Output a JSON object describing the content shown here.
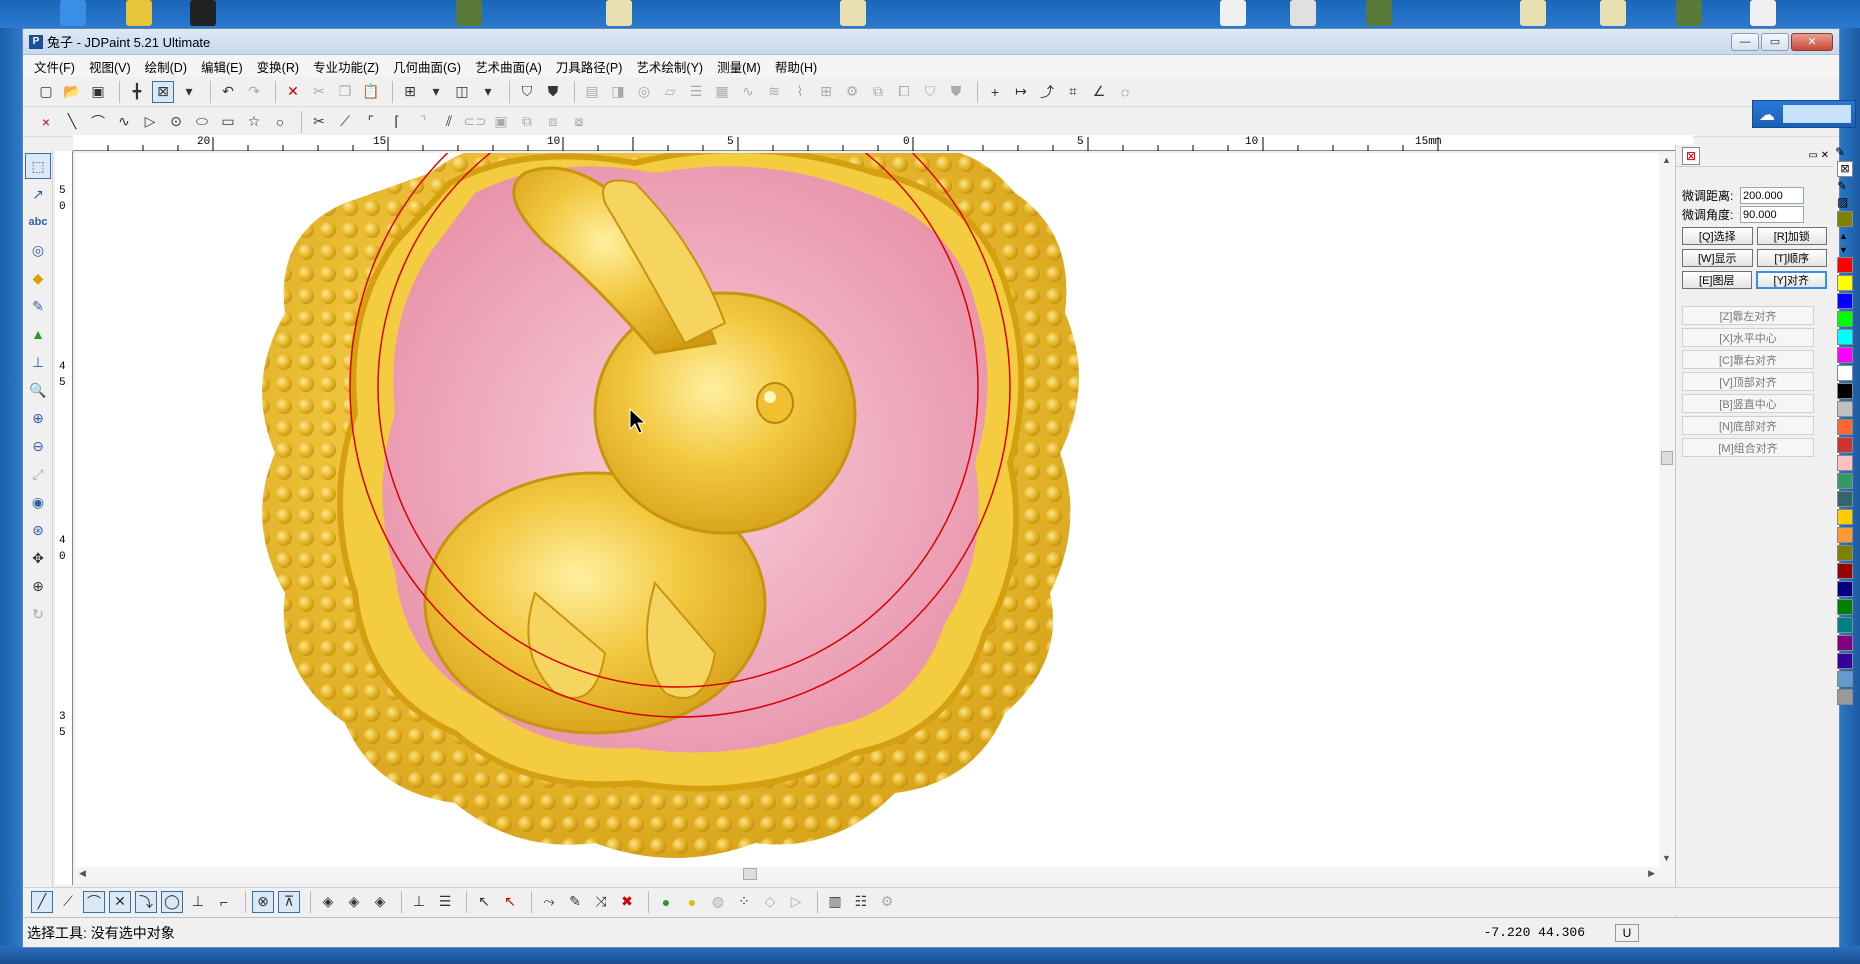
{
  "window": {
    "title": "兔子 - JDPaint 5.21 Ultimate",
    "app_icon": "P"
  },
  "menus": [
    "文件(F)",
    "视图(V)",
    "绘制(D)",
    "编辑(E)",
    "变换(R)",
    "专业功能(Z)",
    "几何曲面(G)",
    "艺术曲面(A)",
    "刀具路径(P)",
    "艺术绘制(Y)",
    "测量(M)",
    "帮助(H)"
  ],
  "ruler": {
    "top_labels": [
      "20",
      "15",
      "10",
      "5",
      "0",
      "5",
      "10",
      "15mm"
    ],
    "left_labels": [
      "5",
      "0",
      "4",
      "5",
      "4",
      "0",
      "3",
      "5"
    ]
  },
  "right_panel": {
    "fine_distance_label": "微调距离:",
    "fine_distance_value": "200.000",
    "fine_angle_label": "微调角度:",
    "fine_angle_value": "90.000",
    "buttons": [
      [
        "[Q]选择",
        "[R]加锁"
      ],
      [
        "[W]显示",
        "[T]顺序"
      ],
      [
        "[E]图层",
        "[Y]对齐"
      ]
    ],
    "align_items": [
      "[Z]靠左对齐",
      "[X]水平中心",
      "[C]靠右对齐",
      "[V]顶部对齐",
      "[B]竖直中心",
      "[N]底部对齐",
      "[M]组合对齐"
    ]
  },
  "palette": {
    "colors": [
      "#ff0000",
      "#ffff00",
      "#0000ff",
      "#00ff00",
      "#00ffff",
      "#ff00ff",
      "#ffffff",
      "#000000",
      "#c0c0c0",
      "#ff6633",
      "#cc3333",
      "#ffc0c0",
      "#339966",
      "#336666",
      "#ffcc00",
      "#ff9933",
      "#808000",
      "#990000",
      "#000080",
      "#008000",
      "#008080",
      "#800080",
      "#330099",
      "#6699cc",
      "#999999"
    ]
  },
  "status": {
    "tool_text": "选择工具: 没有选中对象",
    "coordinates": "-7.220 44.306",
    "unit_button": "U"
  },
  "toolbar_icons": [
    "new-file-icon",
    "open-icon",
    "save-icon",
    "snap-icon",
    "select-box-icon",
    "undo-icon",
    "redo-icon",
    "delete-icon",
    "cut-icon",
    "copy-icon",
    "paste-icon",
    "grid-icon",
    "layer-icon",
    "shield-icon",
    "align-icon",
    "mirror-icon",
    "array-icon",
    "plus-icon",
    "measure-icon",
    "transform-icon"
  ],
  "colors": {
    "title_bar": "#c6d8ee",
    "canvas": "#ffffff",
    "circle_stroke": "#dd0000",
    "gold": "#e6b420",
    "pink": "#f0a6b8"
  }
}
